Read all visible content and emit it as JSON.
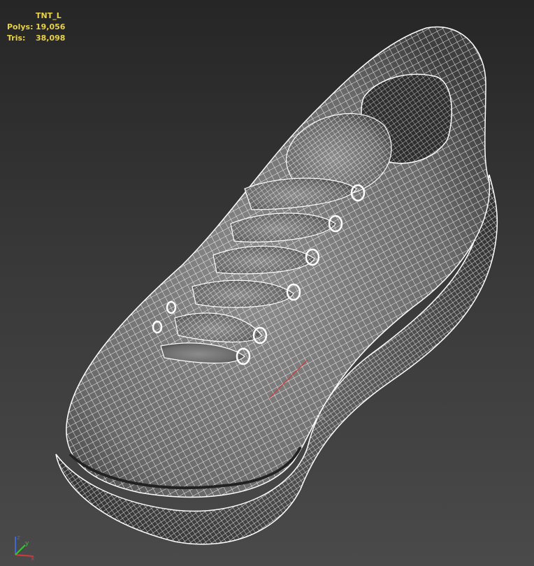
{
  "viewport": {
    "background_top": "#262626",
    "background_bottom": "#4a4a4a",
    "wire_color": "#ffffff",
    "shade_color": "#7a7a7a",
    "stats_color": "#e8d24a"
  },
  "stats": {
    "object_name": "TNT_L",
    "polys_label": "Polys:",
    "polys_value": "19,056",
    "tris_label": "Tris:",
    "tris_value": "38,098"
  },
  "model": {
    "name": "sneaker-wireframe",
    "display_mode": "shaded-wireframe"
  },
  "axis_gizmo": {
    "x_label": "x",
    "y_label": "y",
    "z_label": "z",
    "x_color": "#d23a3a",
    "y_color": "#3ac23a",
    "z_color": "#3a6ad2"
  }
}
